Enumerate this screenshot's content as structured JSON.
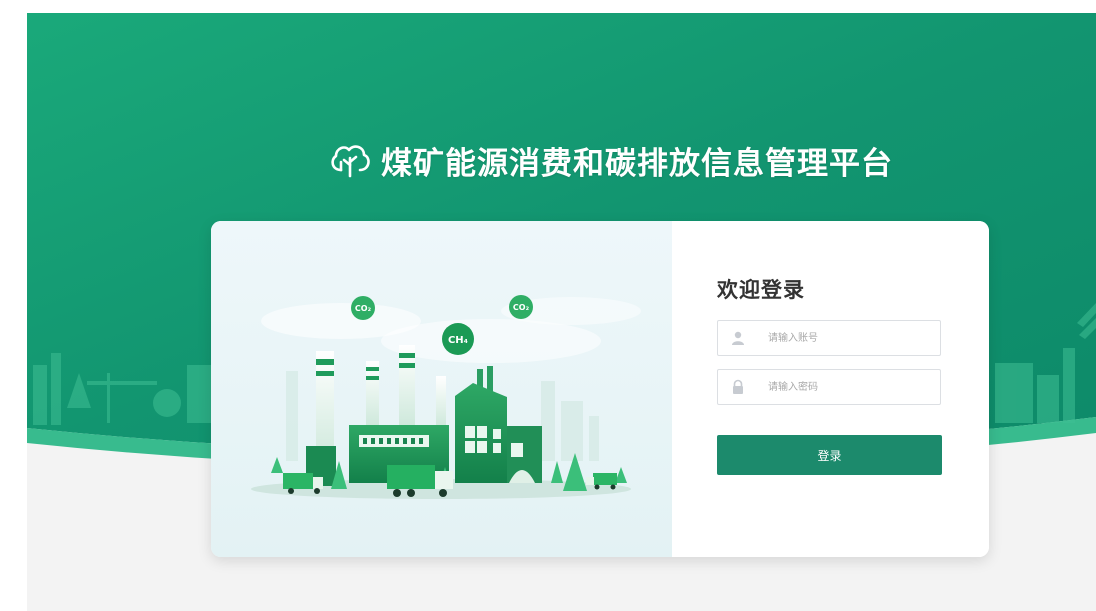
{
  "app": {
    "title": "煤矿能源消费和碳排放信息管理平台",
    "logo_icon": "tree-leaf-logo-icon"
  },
  "colors": {
    "hero_green": "#13976f",
    "hero_green_light": "#22b483",
    "button_green": "#1c8a6c",
    "page_background": "#f3f3f3"
  },
  "illustration": {
    "bubbles": [
      "CO₂",
      "CH₄",
      "CO₂"
    ]
  },
  "login": {
    "title": "欢迎登录",
    "account_placeholder": "请输入账号",
    "password_placeholder": "请输入密码",
    "submit_label": "登录",
    "account_icon": "user-icon",
    "password_icon": "lock-icon"
  }
}
